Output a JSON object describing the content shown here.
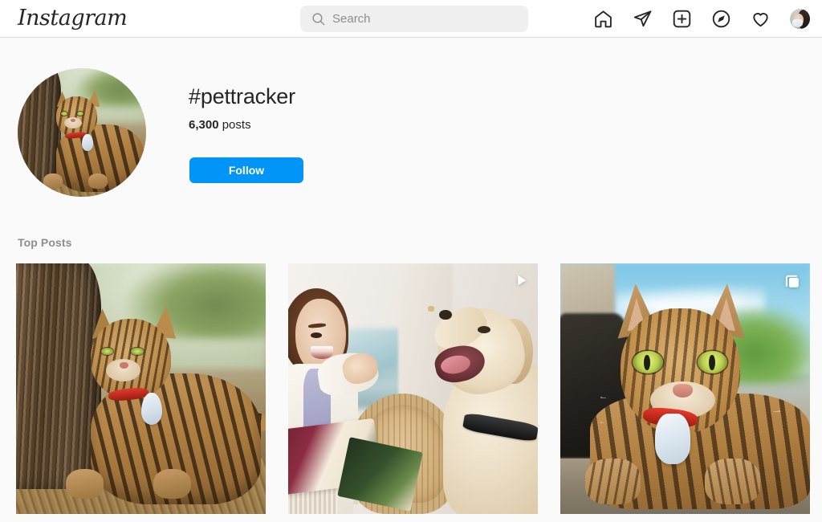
{
  "header": {
    "logo_text": "Instagram",
    "search": {
      "placeholder": "Search",
      "value": "",
      "icon": "search-icon"
    },
    "nav": [
      {
        "name": "home-icon",
        "label": "Home"
      },
      {
        "name": "messenger-icon",
        "label": "Messages"
      },
      {
        "name": "new-post-icon",
        "label": "New post"
      },
      {
        "name": "explore-icon",
        "label": "Explore"
      },
      {
        "name": "activity-heart-icon",
        "label": "Notifications"
      },
      {
        "name": "profile-avatar",
        "label": "Profile"
      }
    ]
  },
  "hashtag": {
    "avatar_alt": "Bengal cat wearing a red collar with a light blue pet tracker tag, lying beside a tree trunk",
    "title": "#pettracker",
    "post_count": "6,300",
    "post_count_suffix": "posts",
    "follow_label": "Follow",
    "follow_color": "#0095F6"
  },
  "top_posts": {
    "section_label": "Top Posts",
    "items": [
      {
        "name": "post-1",
        "alt": "Bengal cat with red collar and blue tracker tag resting against a tree trunk in a park",
        "media_type": "image",
        "overlay_icon": ""
      },
      {
        "name": "post-2",
        "alt": "Woman tossing a treat to a golden retriever sitting indoors beside a wicker chair",
        "media_type": "video",
        "overlay_icon": "play-icon"
      },
      {
        "name": "post-3",
        "alt": "Close-up of a Bengal cat with green eyes, red collar and blue tracker tag on a stone ledge",
        "media_type": "carousel",
        "overlay_icon": "carousel-icon"
      }
    ]
  },
  "colors": {
    "background": "#FAFAFA",
    "surface": "#FFFFFF",
    "border": "#DBDBDB",
    "text_primary": "#262626",
    "text_secondary": "#8E8E8E",
    "accent": "#0095F6",
    "search_field": "#EFEFEF"
  }
}
